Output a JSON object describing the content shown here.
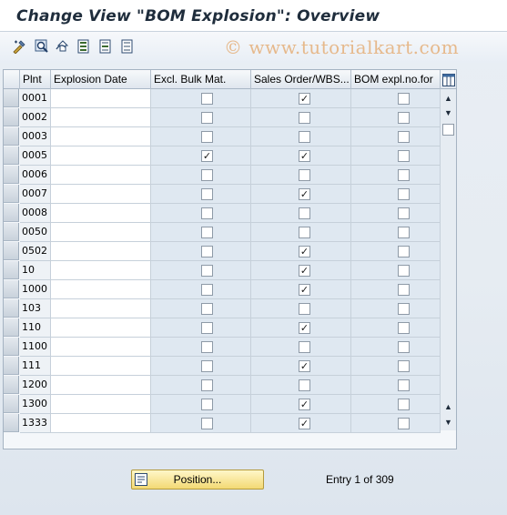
{
  "window": {
    "title": "Change View \"BOM Explosion\": Overview"
  },
  "toolbar": {
    "buttons": [
      {
        "icon": "display-change-icon"
      },
      {
        "icon": "find-icon"
      },
      {
        "icon": "undo-icon"
      },
      {
        "icon": "select-all-icon"
      },
      {
        "icon": "select-block-icon"
      },
      {
        "icon": "deselect-all-icon"
      }
    ]
  },
  "watermark": "© www.tutorialkart.com",
  "table": {
    "columns": [
      "Plnt",
      "Explosion Date",
      "Excl. Bulk Mat.",
      "Sales Order/WBS...",
      "BOM expl.no.for"
    ],
    "settings_icon": "table-settings-icon",
    "rows": [
      {
        "plnt": "0001",
        "date": "",
        "bulk": false,
        "so": true,
        "bom": false
      },
      {
        "plnt": "0002",
        "date": "",
        "bulk": false,
        "so": false,
        "bom": false
      },
      {
        "plnt": "0003",
        "date": "",
        "bulk": false,
        "so": false,
        "bom": false
      },
      {
        "plnt": "0005",
        "date": "",
        "bulk": true,
        "so": true,
        "bom": false
      },
      {
        "plnt": "0006",
        "date": "",
        "bulk": false,
        "so": false,
        "bom": false
      },
      {
        "plnt": "0007",
        "date": "",
        "bulk": false,
        "so": true,
        "bom": false
      },
      {
        "plnt": "0008",
        "date": "",
        "bulk": false,
        "so": false,
        "bom": false
      },
      {
        "plnt": "0050",
        "date": "",
        "bulk": false,
        "so": false,
        "bom": false
      },
      {
        "plnt": "0502",
        "date": "",
        "bulk": false,
        "so": true,
        "bom": false
      },
      {
        "plnt": "10",
        "date": "",
        "bulk": false,
        "so": true,
        "bom": false
      },
      {
        "plnt": "1000",
        "date": "",
        "bulk": false,
        "so": true,
        "bom": false
      },
      {
        "plnt": "103",
        "date": "",
        "bulk": false,
        "so": false,
        "bom": false
      },
      {
        "plnt": "110",
        "date": "",
        "bulk": false,
        "so": true,
        "bom": false
      },
      {
        "plnt": "1100",
        "date": "",
        "bulk": false,
        "so": false,
        "bom": false
      },
      {
        "plnt": "111",
        "date": "",
        "bulk": false,
        "so": true,
        "bom": false
      },
      {
        "plnt": "1200",
        "date": "",
        "bulk": false,
        "so": false,
        "bom": false
      },
      {
        "plnt": "1300",
        "date": "",
        "bulk": false,
        "so": true,
        "bom": false
      },
      {
        "plnt": "1333",
        "date": "",
        "bulk": false,
        "so": true,
        "bom": false
      }
    ]
  },
  "footer": {
    "position_label": "Position...",
    "entry_text": "Entry 1 of 309"
  }
}
